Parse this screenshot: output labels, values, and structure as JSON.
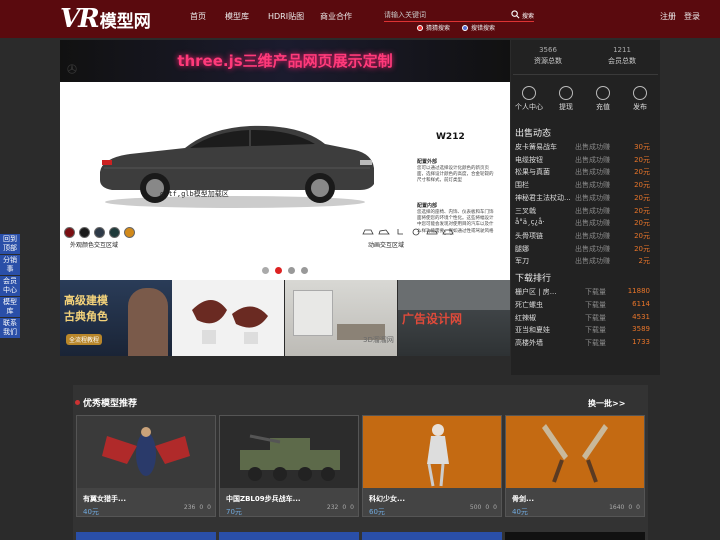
{
  "header": {
    "logo_vr": "VR",
    "logo_text": "模型网",
    "nav": [
      "首页",
      "模型库",
      "HDRI贴图",
      "商业合作"
    ],
    "search_placeholder": "请输入关键词",
    "search_button": "搜索",
    "radio_options": [
      "猜猜搜索",
      "搜错搜索"
    ],
    "login": "注册",
    "register": "登录"
  },
  "hero": {
    "banner_title": "three.js三维产品网页展示定制",
    "model_name": "W212",
    "spec1_head": "配置外部",
    "spec1_body": "您可以通过选择设计化颜色的新页页面，选择设计颜色的高度，合金轮毂的尺寸和样式，前灯类型",
    "spec2_head": "配置内部",
    "spec2_body": "您选择的座椅、内饰、仪表板和车门饰面将使您的环境个性化。这些将幅设计中您可能会发现对使用目的汽车以及什么样功能需要，例如通过性或驾驶风格",
    "car_label": "gltf,glb模型加载区",
    "swatch_label": "外观颜色交互区域",
    "anim_label": "动画交互区域",
    "swatch_colors": [
      "#7a0f13",
      "#1a1a1a",
      "#2e3a48",
      "#1e3a3a",
      "#d28a1a"
    ]
  },
  "thumbs": [
    {
      "title": "高级建模",
      "subtitle": "古典角色",
      "tag": "全流程教程"
    },
    {
      "title": ""
    },
    {
      "title": "3D溜溜网"
    },
    {
      "title": "广告设计网"
    }
  ],
  "stats": [
    {
      "num": "3566",
      "label": "资源总数"
    },
    {
      "num": "1211",
      "label": "会员总数"
    }
  ],
  "quick": [
    "个人中心",
    "提现",
    "充值",
    "发布"
  ],
  "sales": {
    "title": "出售动态",
    "status": "出售成功赚",
    "rows": [
      {
        "name": "皮卡簧易战车",
        "price": "30元"
      },
      {
        "name": "电缆按钮",
        "price": "20元"
      },
      {
        "name": "松果与真菌",
        "price": "20元"
      },
      {
        "name": "围栏",
        "price": "20元"
      },
      {
        "name": "神秘君主法杖动...",
        "price": "20元"
      },
      {
        "name": "三叉戟",
        "price": "20元"
      },
      {
        "name": "å°ä¸ç¿å·",
        "price": "20元"
      },
      {
        "name": "头骨项链",
        "price": "20元"
      },
      {
        "name": "腿娜",
        "price": "20元"
      },
      {
        "name": "军刀",
        "price": "2元"
      }
    ]
  },
  "downloads": {
    "title": "下载排行",
    "status": "下载量",
    "rows": [
      {
        "name": "栅户区 | 房...",
        "count": "11880"
      },
      {
        "name": "死亡螺虫",
        "count": "6114"
      },
      {
        "name": "红辣椒",
        "count": "4531"
      },
      {
        "name": "亚当和夏娃",
        "count": "3589"
      },
      {
        "name": "高楼外墙",
        "count": "1733"
      }
    ]
  },
  "side_tabs": [
    "回到顶部",
    "分销事",
    "会员中心",
    "模型库",
    "联系我们"
  ],
  "recommend": {
    "title": "优秀模型推荐",
    "more": "换一批>>",
    "cards": [
      {
        "name": "有翼女猎手...",
        "price": "40元",
        "views": "236",
        "likes": "0",
        "dl": "0"
      },
      {
        "name": "中国ZBL09步兵战车...",
        "price": "70元",
        "views": "232",
        "likes": "0",
        "dl": "0"
      },
      {
        "name": "科幻少女...",
        "price": "60元",
        "views": "500",
        "likes": "0",
        "dl": "0"
      },
      {
        "name": "骨剑...",
        "price": "40元",
        "views": "1640",
        "likes": "0",
        "dl": "0"
      }
    ]
  },
  "colors": {
    "topbar": "#5a0a0e",
    "accent_price": "#e8752a",
    "side_tab": "#2a4fa8"
  }
}
